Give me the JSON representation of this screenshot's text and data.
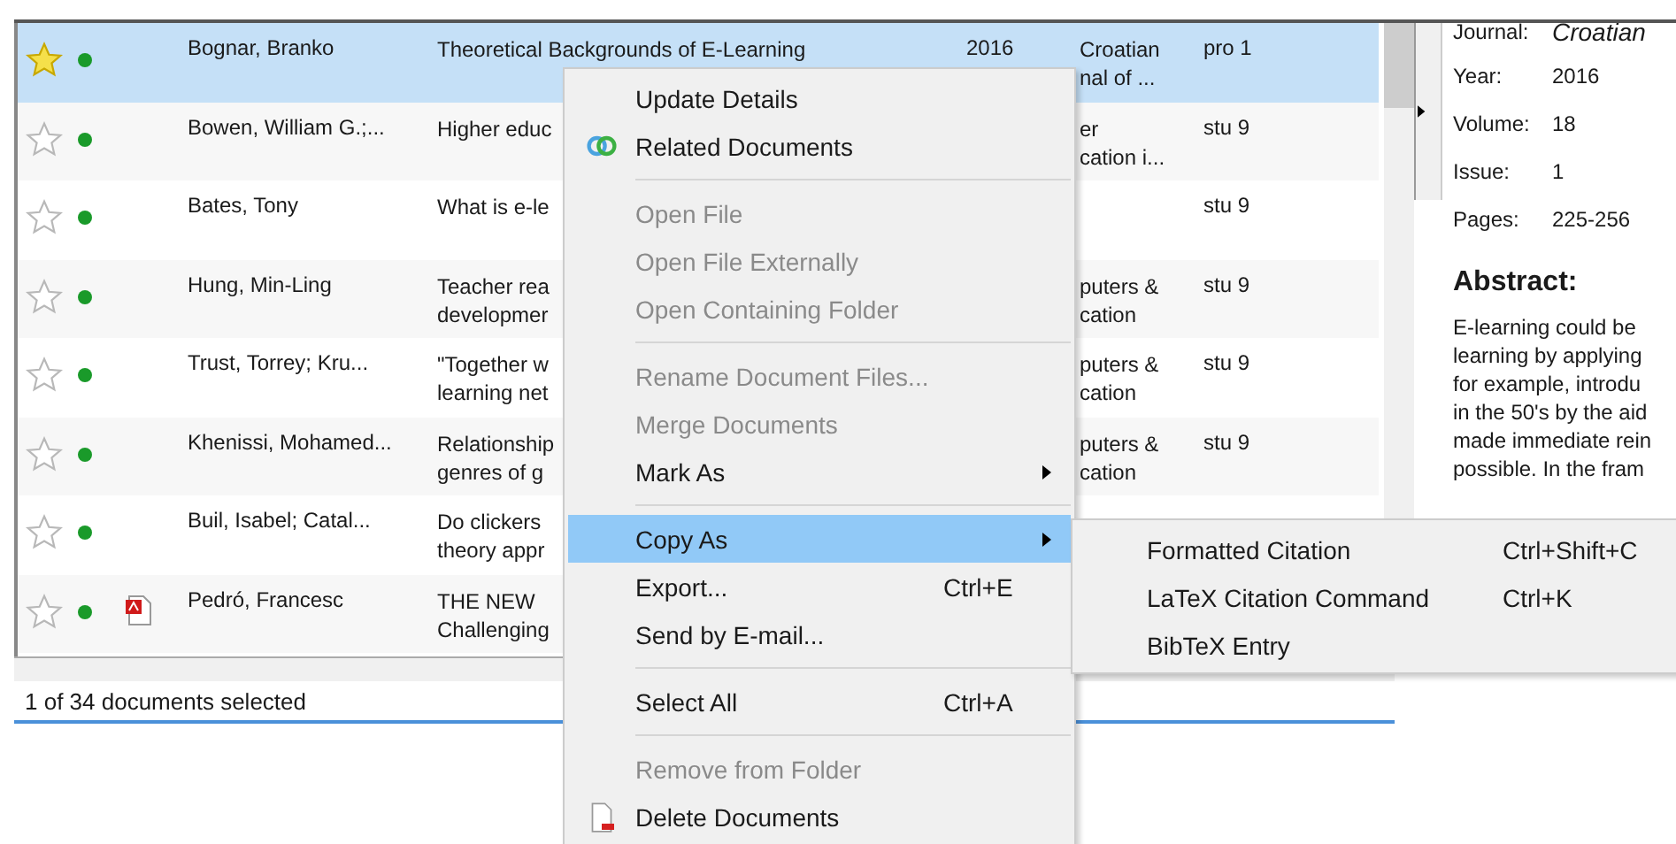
{
  "documents": [
    {
      "starred": true,
      "selected": true,
      "has_file": false,
      "authors": "Bognar, Branko",
      "title": [
        "Theoretical Backgrounds of E-Learning"
      ],
      "year": "2016",
      "publication": [
        "Croatian",
        "nal of ..."
      ],
      "tags": "pro 1"
    },
    {
      "starred": false,
      "selected": false,
      "has_file": false,
      "authors": "Bowen, William G.;...",
      "title": [
        "Higher educ"
      ],
      "publication": [
        "er",
        "cation i..."
      ],
      "tags": "stu 9"
    },
    {
      "starred": false,
      "selected": false,
      "has_file": false,
      "authors": "Bates, Tony",
      "title": [
        "What is e-le"
      ],
      "tags": "stu 9"
    },
    {
      "starred": false,
      "selected": false,
      "has_file": false,
      "authors": "Hung, Min-Ling",
      "title": [
        "Teacher rea",
        "developmer"
      ],
      "publication": [
        "puters &",
        "cation"
      ],
      "tags": "stu 9"
    },
    {
      "starred": false,
      "selected": false,
      "has_file": false,
      "authors": "Trust, Torrey; Kru...",
      "title": [
        "\"Together w",
        "learning net"
      ],
      "publication": [
        "puters &",
        "cation"
      ],
      "tags": "stu 9"
    },
    {
      "starred": false,
      "selected": false,
      "has_file": false,
      "authors": "Khenissi, Mohamed...",
      "title": [
        "Relationship",
        "genres of g"
      ],
      "publication": [
        "puters &",
        "cation"
      ],
      "tags": "stu 9"
    },
    {
      "starred": false,
      "selected": false,
      "has_file": false,
      "authors": "Buil, Isabel; Catal...",
      "title": [
        "Do clickers",
        "theory appr"
      ]
    },
    {
      "starred": false,
      "selected": false,
      "has_file": true,
      "authors": "Pedró, Francesc",
      "title": [
        "THE NEW",
        "Challenging"
      ]
    }
  ],
  "status_bar": "1 of 34 documents selected",
  "details": {
    "journal_label": "Journal:",
    "journal": "Croatian",
    "fields": [
      {
        "label": "Year:",
        "value": "2016"
      },
      {
        "label": "Volume:",
        "value": "18"
      },
      {
        "label": "Issue:",
        "value": "1"
      },
      {
        "label": "Pages:",
        "value": "225-256"
      }
    ],
    "abstract_heading": "Abstract:",
    "abstract_lines": [
      "E-learning could be",
      "learning by applying",
      "for example, introdu",
      "in the 50's by the aid",
      "made immediate rein",
      "possible. In the fram"
    ]
  },
  "context_menu": [
    {
      "kind": "item",
      "label": "Update Details",
      "disabled": false,
      "selected": false
    },
    {
      "kind": "linked-item",
      "label": "Related Documents",
      "disabled": false,
      "selected": false
    },
    {
      "kind": "separator"
    },
    {
      "kind": "item",
      "label": "Open File",
      "disabled": true,
      "selected": false
    },
    {
      "kind": "item",
      "label": "Open File Externally",
      "disabled": true,
      "selected": false
    },
    {
      "kind": "item",
      "label": "Open Containing Folder",
      "disabled": true,
      "selected": false
    },
    {
      "kind": "separator"
    },
    {
      "kind": "item",
      "label": "Rename Document Files...",
      "disabled": true,
      "selected": false
    },
    {
      "kind": "item",
      "label": "Merge Documents",
      "disabled": true,
      "selected": false
    },
    {
      "kind": "item",
      "label": "Mark As",
      "disabled": false,
      "selected": false,
      "submenu": true
    },
    {
      "kind": "separator"
    },
    {
      "kind": "item",
      "label": "Copy As",
      "disabled": false,
      "selected": true,
      "submenu": true
    },
    {
      "kind": "item",
      "label": "Export...",
      "shortcut": "Ctrl+E",
      "disabled": false,
      "selected": false
    },
    {
      "kind": "item",
      "label": "Send by E-mail...",
      "disabled": false,
      "selected": false
    },
    {
      "kind": "separator"
    },
    {
      "kind": "item",
      "label": "Select All",
      "shortcut": "Ctrl+A",
      "disabled": false,
      "selected": false
    },
    {
      "kind": "separator"
    },
    {
      "kind": "item",
      "label": "Remove from Folder",
      "disabled": true,
      "selected": false
    },
    {
      "kind": "delete-item",
      "label": "Delete Documents",
      "disabled": false,
      "selected": false
    }
  ],
  "submenu": [
    {
      "label": "Formatted Citation",
      "shortcut": "Ctrl+Shift+C"
    },
    {
      "label": "LaTeX Citation Command",
      "shortcut": "Ctrl+K"
    },
    {
      "label": "BibTeX Entry"
    }
  ]
}
